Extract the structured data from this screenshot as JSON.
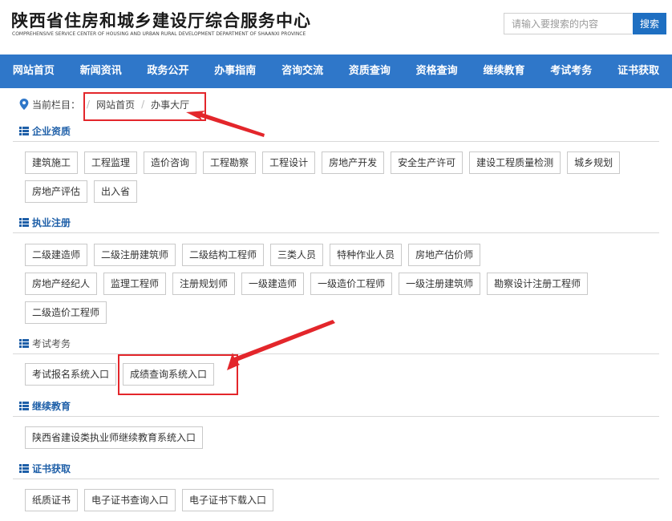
{
  "header": {
    "title": "陕西省住房和城乡建设厅综合服务中心",
    "subtitle": "COMPREHENSIVE SERVICE CENTER OF HOUSING AND URBAN RURAL DEVELOPMENT DEPARTMENT OF SHAANXI PROVINCE",
    "search_placeholder": "请输入要搜索的内容",
    "search_button": "搜索"
  },
  "nav": [
    "网站首页",
    "新闻资讯",
    "政务公开",
    "办事指南",
    "咨询交流",
    "资质查询",
    "资格查询",
    "继续教育",
    "考试考务",
    "证书获取"
  ],
  "breadcrumb": {
    "label": "当前栏目：",
    "items": [
      "网站首页",
      "办事大厅"
    ]
  },
  "sections": [
    {
      "title": "企业资质",
      "rows": [
        [
          "建筑施工",
          "工程监理",
          "造价咨询",
          "工程勘察",
          "工程设计",
          "房地产开发",
          "安全生产许可",
          "建设工程质量检测",
          "城乡规划"
        ],
        [
          "房地产评估",
          "出入省"
        ]
      ]
    },
    {
      "title": "执业注册",
      "rows": [
        [
          "二级建造师",
          "二级注册建筑师",
          "二级结构工程师",
          "三类人员",
          "特种作业人员",
          "房地产估价师"
        ],
        [
          "房地产经纪人",
          "监理工程师",
          "注册规划师",
          "一级建造师",
          "一级造价工程师",
          "一级注册建筑师",
          "勘察设计注册工程师"
        ],
        [
          "二级造价工程师"
        ]
      ]
    },
    {
      "title": "考试考务",
      "rows": [
        [
          "考试报名系统入口",
          "成绩查询系统入口"
        ]
      ]
    },
    {
      "title": "继续教育",
      "rows": [
        [
          "陕西省建设类执业师继续教育系统入口"
        ]
      ]
    },
    {
      "title": "证书获取",
      "rows": [
        [
          "纸质证书",
          "电子证书查询入口",
          "电子证书下载入口"
        ]
      ]
    }
  ],
  "colors": {
    "nav_bg": "#2f77c9",
    "accent": "#1e6fc2",
    "section_title": "#1e5fa8",
    "annotation": "#e3262b"
  }
}
